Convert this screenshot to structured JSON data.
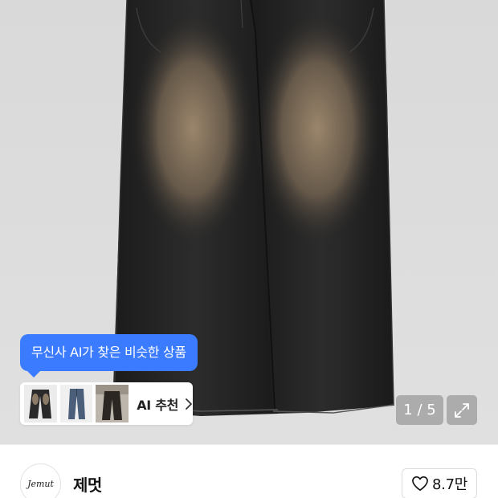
{
  "gallery": {
    "tooltip_text": "무신사 AI가 찾은 비슷한 상품",
    "ai_recommend_label": "AI 추천",
    "page_indicator": "1 / 5",
    "product_photo_icon": "black-wide-denim-pants-photo",
    "expand_icon": "expand-arrows-icon"
  },
  "brand": {
    "logo_text": "Jemut",
    "name": "제멋"
  },
  "like": {
    "icon": "heart-outline-icon",
    "count": "8.7만"
  }
}
